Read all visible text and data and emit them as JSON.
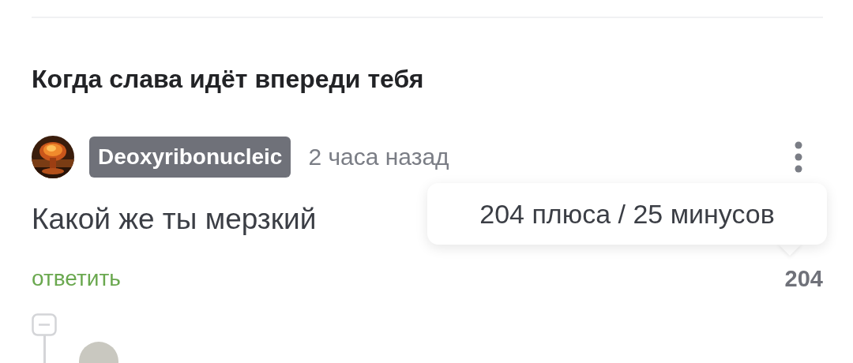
{
  "post": {
    "title": "Когда слава идёт впереди тебя"
  },
  "comment": {
    "author": "Deoxyribonucleic",
    "time": "2 часа назад",
    "text": "Какой же ты мерзкий",
    "reply": "ответить",
    "rating": "204",
    "tooltip": "204 плюса / 25 минусов",
    "expanded": true
  }
}
